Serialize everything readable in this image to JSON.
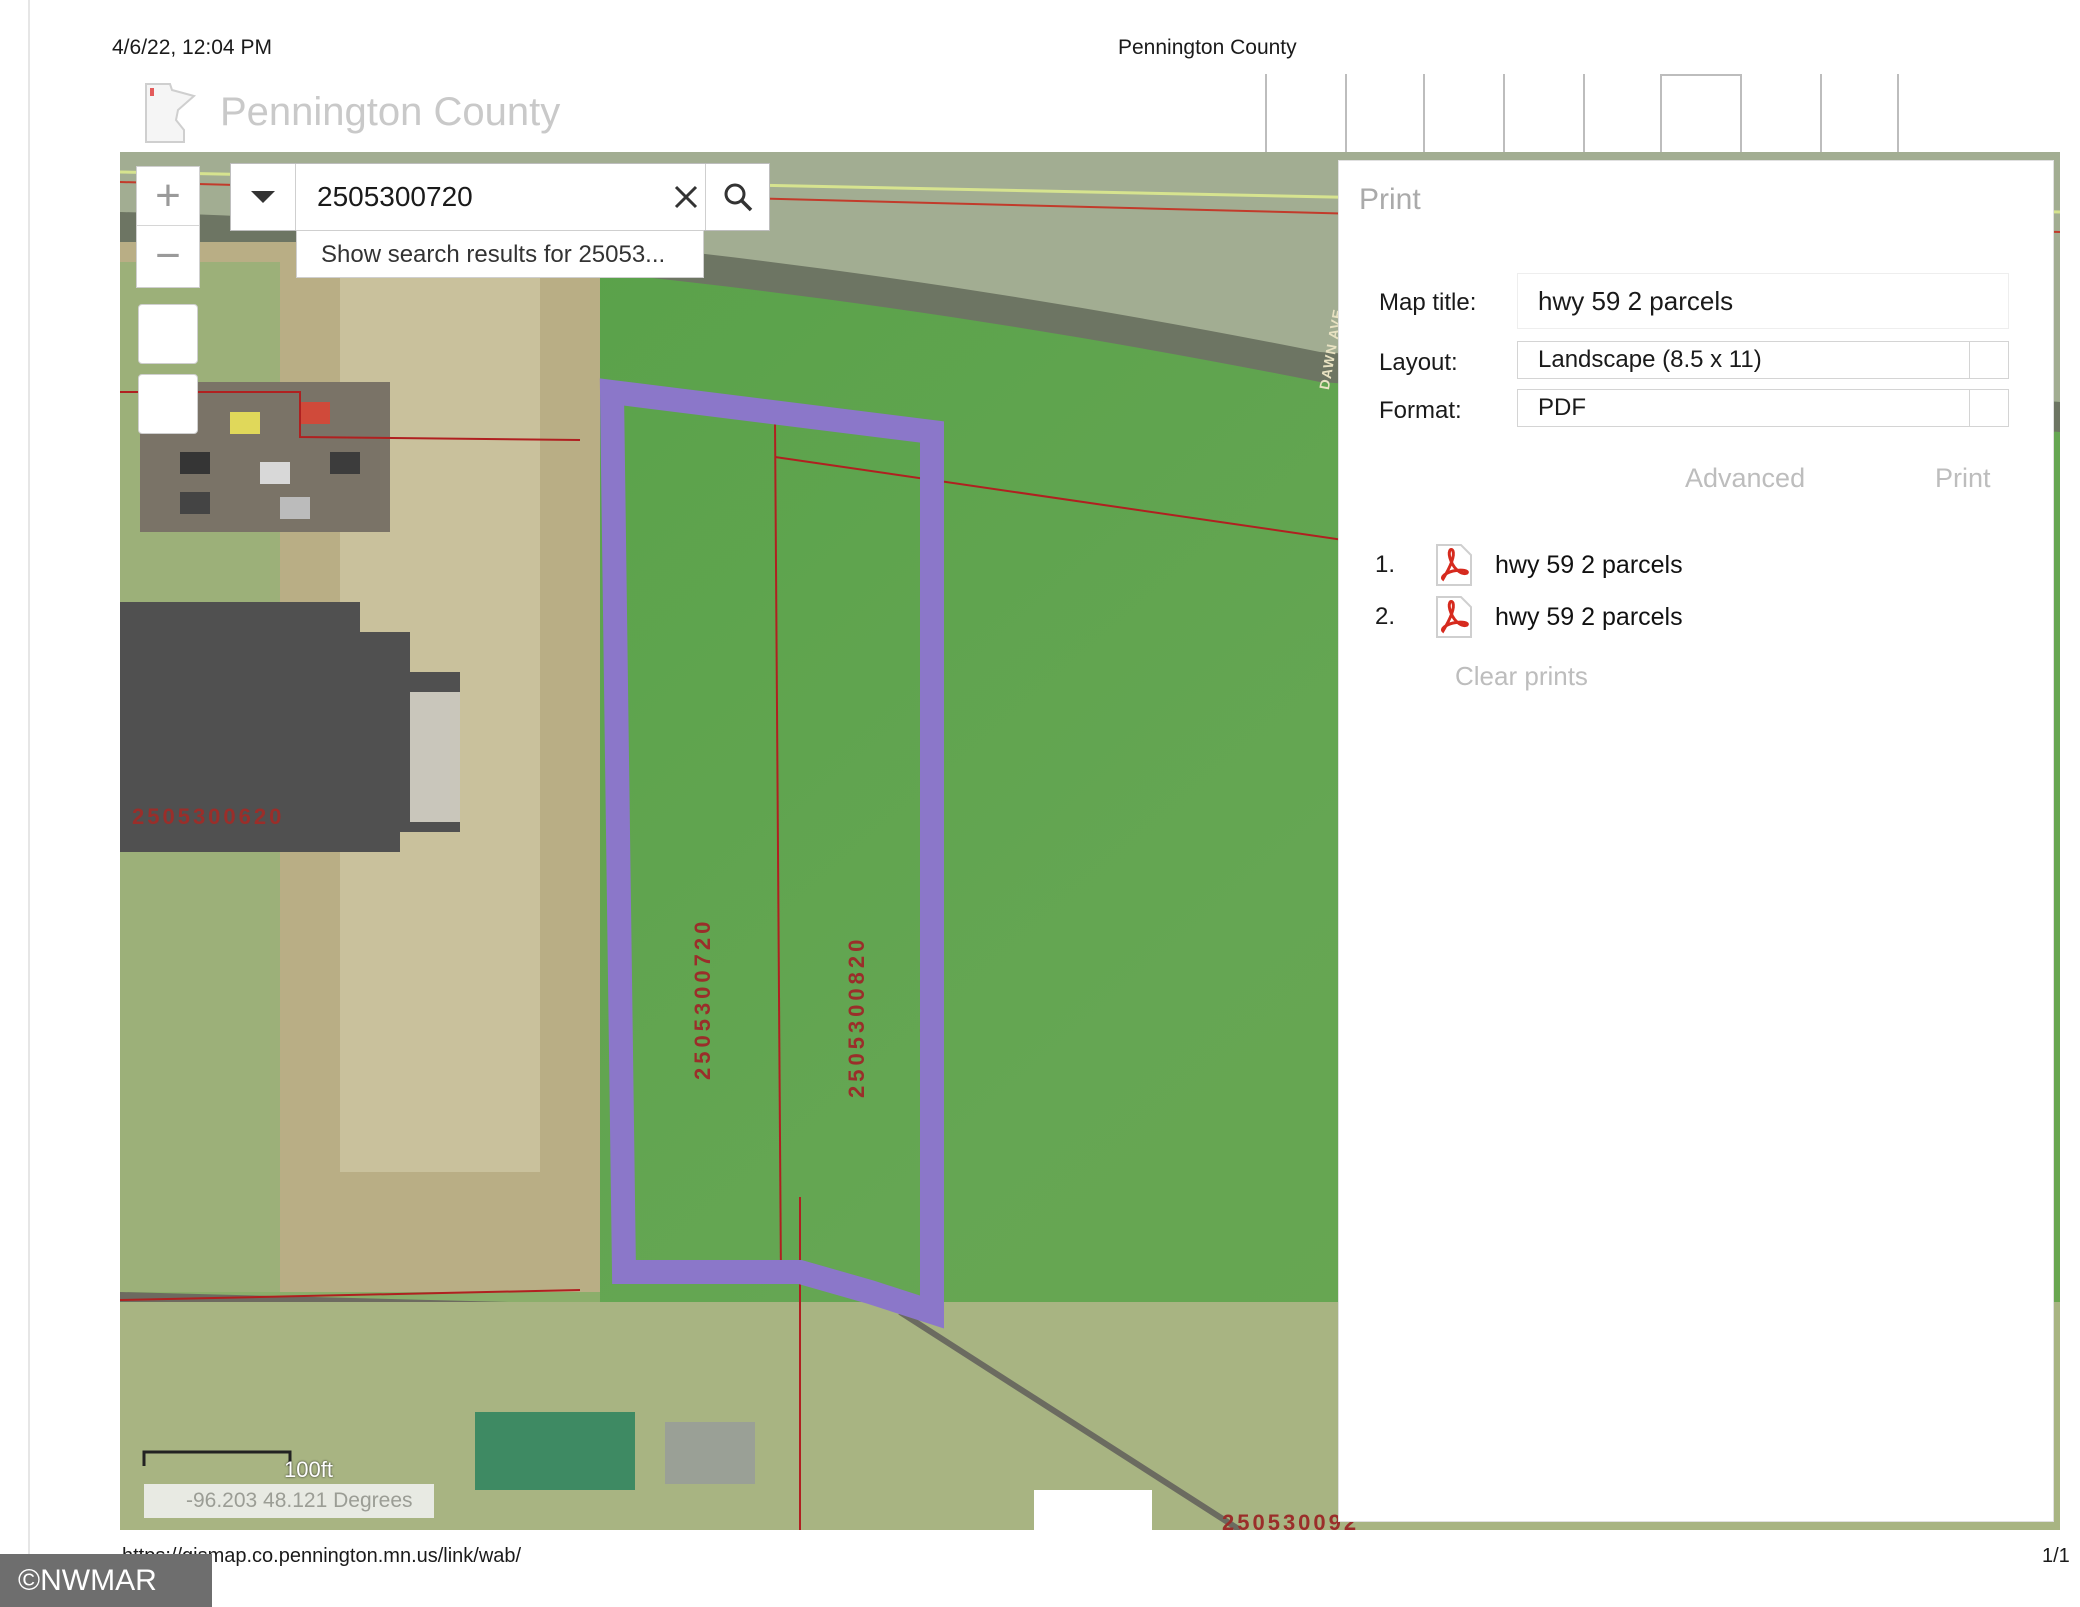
{
  "print_header": {
    "datetime": "4/6/22, 12:04 PM",
    "title": "Pennington County"
  },
  "app": {
    "title": "Pennington County"
  },
  "search": {
    "value": "2505300720",
    "suggestion": "Show search results for 25053..."
  },
  "zoom": {
    "in_label": "+",
    "out_label": "−"
  },
  "parcels": {
    "labels": [
      "2505300720",
      "2505300820",
      "2505300620",
      "250530092"
    ]
  },
  "scale": {
    "label": "100ft"
  },
  "coordinates": "-96.203 48.121 Degrees",
  "print_panel": {
    "title": "Print",
    "map_title_label": "Map title:",
    "map_title_value": "hwy 59 2 parcels",
    "layout_label": "Layout:",
    "layout_value": "Landscape (8.5 x 11)",
    "format_label": "Format:",
    "format_value": "PDF",
    "advanced": "Advanced",
    "print": "Print",
    "results": [
      {
        "num": "1.",
        "label": "hwy 59 2 parcels"
      },
      {
        "num": "2.",
        "label": "hwy 59 2 parcels"
      }
    ],
    "clear_prints": "Clear prints"
  },
  "road_label": "DAWN AVE",
  "footer": {
    "url": "https://gismap.co.pennington.mn.us/link/wab/",
    "page": "1/1"
  },
  "watermark": "©NWMAR",
  "colors": {
    "highlight": "#8b77c9",
    "parcel_line": "#b02020",
    "parcel_label": "#9a2e2a",
    "field_green": "#5aa24a"
  },
  "icons": {
    "dropdown": "chevron-down-icon",
    "clear": "close-icon",
    "search": "search-icon",
    "pdf": "pdf-file-icon",
    "logo": "minnesota-state-icon"
  }
}
